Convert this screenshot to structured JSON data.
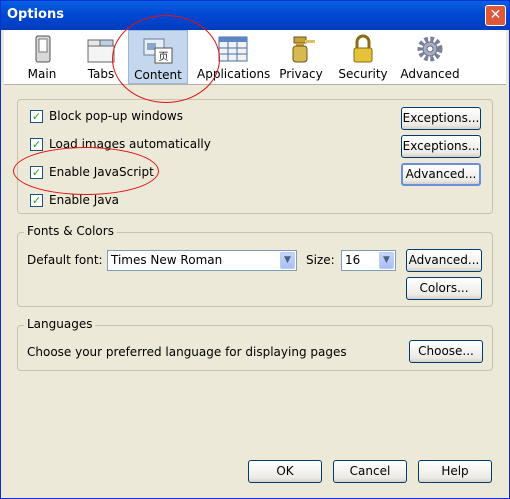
{
  "window": {
    "title": "Options",
    "close_glyph": "✕"
  },
  "tabs": [
    {
      "label": "Main",
      "icon": "main-icon"
    },
    {
      "label": "Tabs",
      "icon": "tabs-icon"
    },
    {
      "label": "Content",
      "icon": "content-icon",
      "selected": true
    },
    {
      "label": "Applications",
      "icon": "applications-icon"
    },
    {
      "label": "Privacy",
      "icon": "privacy-icon"
    },
    {
      "label": "Security",
      "icon": "security-icon"
    },
    {
      "label": "Advanced",
      "icon": "advanced-icon"
    }
  ],
  "content_options": {
    "checkboxes": [
      {
        "label": "Block pop-up windows",
        "checked": true
      },
      {
        "label": "Load images automatically",
        "checked": true
      },
      {
        "label": "Enable JavaScript",
        "checked": true
      },
      {
        "label": "Enable Java",
        "checked": true
      }
    ],
    "exceptions_label_1": "Exceptions...",
    "exceptions_label_2": "Exceptions...",
    "advanced_label": "Advanced...",
    "check_glyph": "✓"
  },
  "fonts": {
    "group_title": "Fonts & Colors",
    "default_font_label": "Default font:",
    "default_font_value": "Times New Roman",
    "size_label": "Size:",
    "size_value": "16",
    "advanced_label": "Advanced...",
    "colors_label": "Colors...",
    "dropdown_glyph": "▼"
  },
  "languages": {
    "group_title": "Languages",
    "description": "Choose your preferred language for displaying pages",
    "choose_label": "Choose..."
  },
  "footer": {
    "ok_label": "OK",
    "cancel_label": "Cancel",
    "help_label": "Help"
  },
  "colors": {
    "titlebar": "#0054e3",
    "dialog_bg": "#ece9d8",
    "annotation": "#e21414",
    "selected_tab": "#c5d7ec"
  }
}
